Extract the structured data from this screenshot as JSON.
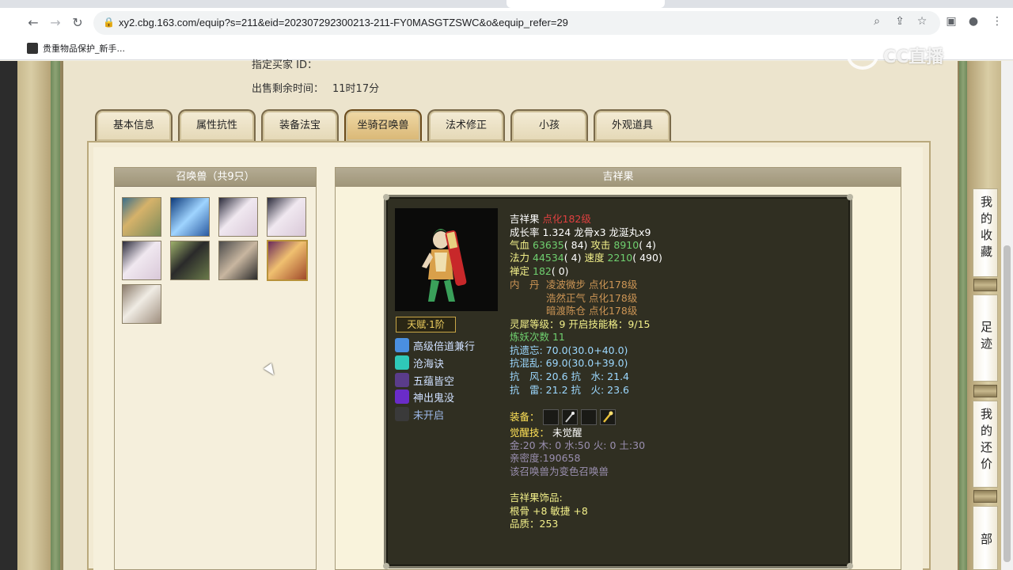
{
  "browser": {
    "url": "xy2.cbg.163.com/equip?s=211&eid=202307292300213-211-FY0MASGTZSWC&o&equip_refer=29",
    "bookmark": "贵重物品保护_新手...",
    "watermark": "CC直播"
  },
  "header": {
    "buyer_label": "指定买家 ID：",
    "time_label": "出售剩余时间：",
    "time_value": "11时17分"
  },
  "tabs": [
    {
      "label": "基本信息"
    },
    {
      "label": "属性抗性"
    },
    {
      "label": "装备法宝"
    },
    {
      "label": "坐骑召唤兽",
      "active": true
    },
    {
      "label": "法术修正"
    },
    {
      "label": "小孩"
    },
    {
      "label": "外观道具"
    }
  ],
  "summons": {
    "title": "召唤兽（共9只）",
    "selected_index": 7
  },
  "detail": {
    "title": "吉祥果",
    "name": "吉祥果",
    "level_text": "点化182级",
    "growth": "成长率 1.324 龙骨x3 龙涎丸x9",
    "hp_label": "气血",
    "hp_value": "63635",
    "hp_extra": "( 84)",
    "atk_label": "攻击",
    "atk_value": "8910",
    "atk_extra": "( 4)",
    "mp_label": "法力",
    "mp_value": "44534",
    "mp_extra": "( 4)",
    "spd_label": "速度",
    "spd_value": "2210",
    "spd_extra": "( 490)",
    "calm_label": "禅定",
    "calm_value": "182",
    "calm_extra": "( 0)",
    "inner_label": "内　丹",
    "inner_1": "凌波微步 点化178级",
    "inner_2": "浩然正气 点化178级",
    "inner_3": "暗渡陈仓 点化178级",
    "spirit": "灵犀等级：9 开启技能格：9/15",
    "refine": "炼妖次数 11",
    "res_forget": "抗遗忘: 70.0(30.0+40.0)",
    "res_chaos": "抗混乱: 69.0(30.0+39.0)",
    "res_wind_water": "抗　风: 20.6 抗　水: 21.4",
    "res_thunder_fire": "抗　雷: 21.2 抗　火: 23.6",
    "equip_label": "装备：",
    "awaken_label": "觉醒技：",
    "awaken_value": "未觉醒",
    "elements": "金:20 木: 0 水:50 火: 0 土:30",
    "intimacy": "亲密度:190658",
    "variant": "该召唤兽为变色召唤兽",
    "ornament_title": "吉祥果饰品:",
    "ornament_stats": "根骨 +8 敏捷 +8",
    "ornament_quality": "品质：253",
    "talent": "天赋·1阶",
    "skills": [
      {
        "label": "高级倍道兼行",
        "color": "#4a8fe0"
      },
      {
        "label": "沧海诀",
        "color": "#2fc8b8"
      },
      {
        "label": "五蕴皆空",
        "color": "#5a3c8a"
      },
      {
        "label": "神出鬼没",
        "color": "#6a2cc8"
      },
      {
        "label": "未开启",
        "color": "#3a3a3a"
      }
    ]
  },
  "side_buttons": [
    {
      "label": "我的收藏"
    },
    {
      "label": "足迹"
    },
    {
      "label": "我的还价"
    },
    {
      "label": "返回顶部"
    }
  ],
  "colors": {
    "accent_red": "#e04040",
    "text_green": "#6fd06f",
    "text_yellow": "#f3f08a",
    "text_orange": "#cc9555"
  }
}
